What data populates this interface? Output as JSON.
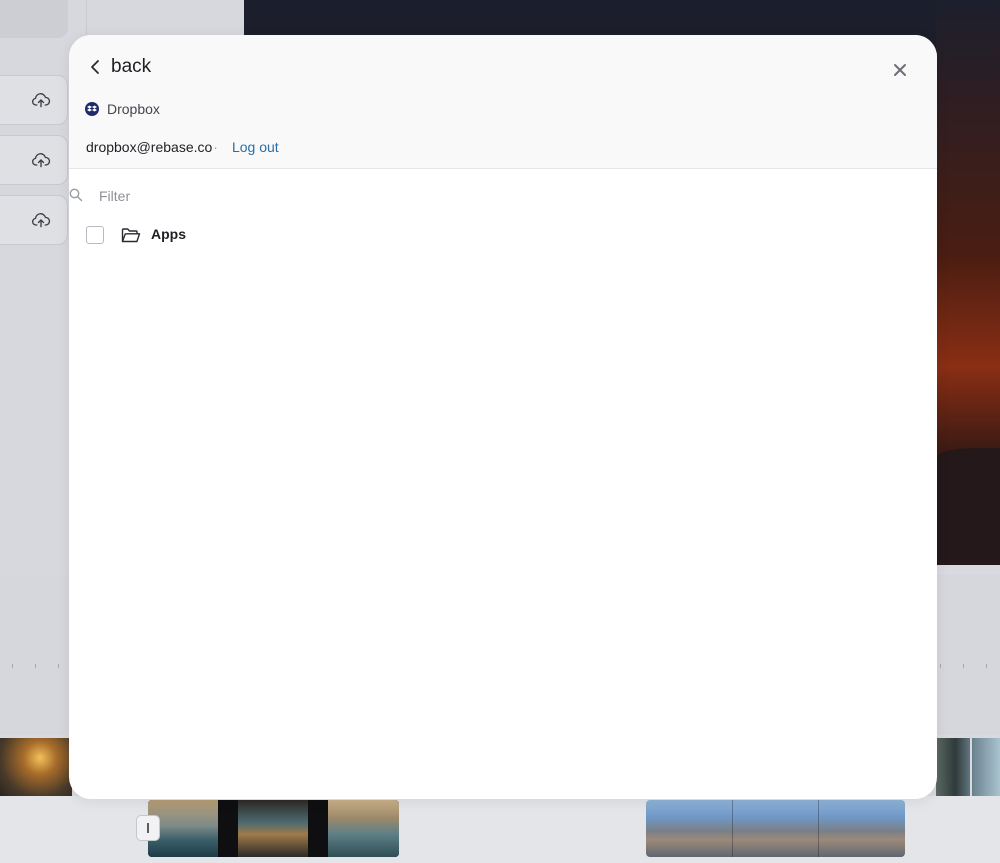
{
  "modal": {
    "back_label": "back",
    "provider_name": "Dropbox",
    "account_email": "dropbox@rebase.co",
    "account_separator": "·",
    "logout_label": "Log out",
    "filter_placeholder": "Filter",
    "filter_value": ""
  },
  "file_list": {
    "items": [
      {
        "label": "Apps",
        "type": "folder",
        "checked": false
      }
    ]
  },
  "icons": {
    "back": "chevron-left-icon",
    "close": "close-icon",
    "provider": "dropbox-icon",
    "filter": "search-icon",
    "folder": "folder-open-icon",
    "upload": "cloud-upload-icon"
  },
  "colors": {
    "link": "#2c6da3",
    "dropbox_brand": "#1d2b6c",
    "modal_header_bg": "#f9f9fa"
  }
}
